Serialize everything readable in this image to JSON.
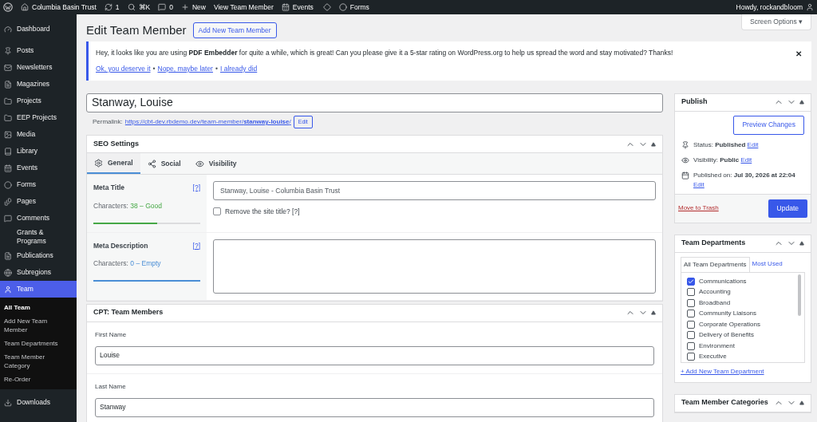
{
  "admin_bar": {
    "items": [
      "Columbia Basin Trust",
      "1",
      "⌘K",
      "0",
      "New",
      "View Team Member",
      "Events",
      "Forms"
    ],
    "account": "Howdy, rockandbloom"
  },
  "sidebar": {
    "items": [
      {
        "label": "Dashboard",
        "selected": false
      },
      {
        "label": "Posts",
        "selected": false
      },
      {
        "label": "Newsletters",
        "selected": false
      },
      {
        "label": "Magazines",
        "selected": false
      },
      {
        "label": "Projects",
        "selected": false
      },
      {
        "label": "EEP Projects",
        "selected": false
      },
      {
        "label": "Media",
        "selected": false
      },
      {
        "label": "Library",
        "selected": false
      },
      {
        "label": "Events",
        "selected": false
      },
      {
        "label": "Forms",
        "selected": false
      },
      {
        "label": "Pages",
        "selected": false
      },
      {
        "label": "Comments",
        "selected": false
      },
      {
        "label": "Grants & Programs",
        "selected": false
      },
      {
        "label": "Publications",
        "selected": false
      },
      {
        "label": "Subregions",
        "selected": false
      },
      {
        "label": "Team",
        "selected": true,
        "children": [
          {
            "label": "All Team",
            "selected": true
          },
          {
            "label": "Add New Team Member",
            "selected": false
          },
          {
            "label": "Team Departments",
            "selected": false
          },
          {
            "label": "Team Member Category",
            "selected": false
          },
          {
            "label": "Re-Order",
            "selected": false
          }
        ]
      },
      {
        "label": "Downloads",
        "selected": false
      }
    ]
  },
  "page": {
    "title": "Edit Team Member",
    "add_button": "Add New Team Member",
    "screen_options": "Screen Options ▾"
  },
  "notice": {
    "text": "Hey, it looks like you are using **PDF Embedder** for quite a while, which is great! Can you please give it a 5-star rating on WordPress.org to help us spread the word and stay motivated? Thanks!",
    "links": [
      "Ok, you deserve it",
      "Nope, maybe later",
      "I already did"
    ],
    "separator": "•",
    "dismiss": "✕"
  },
  "post_title": "Stanway, Louise",
  "permalink": {
    "label": "Permalink:",
    "url": "https://cbt-dev.rbdemo.dev/team-member/**stanway-louise**/",
    "edit": "Edit"
  },
  "seo": {
    "title": "SEO Settings",
    "tabs": [
      {
        "label": "General",
        "selected": true
      },
      {
        "label": "Social",
        "selected": false
      },
      {
        "label": "Visibility",
        "selected": false
      }
    ],
    "fields": [
      {
        "kind": "input",
        "label": "Meta Title",
        "help": "[?]",
        "counter": "Characters: ",
        "count": "38 – Good",
        "color": "#46a846",
        "level": 0.6,
        "value": "Stanway, Louise - Columbia Basin Trust",
        "checkbox": {
          "label": "Remove the site title? [?]",
          "checked": false
        }
      },
      {
        "kind": "textarea",
        "label": "Meta Description",
        "help": "[?]",
        "counter": "Characters: ",
        "count": "0 – Empty",
        "color": "#4a8ed6",
        "level": 1
      }
    ]
  },
  "cpt": {
    "title": "CPT: Team Members",
    "fields": [
      {
        "label": "First Name",
        "value": "Louise"
      },
      {
        "label": "Last Name",
        "value": "Stanway"
      }
    ]
  },
  "publish": {
    "title": "Publish",
    "preview": "Preview Changes",
    "rows": [
      {
        "text": "Status: **Published**",
        "edit": "Edit"
      },
      {
        "text": "Visibility: **Public**",
        "edit": "Edit"
      },
      {
        "text": "Published on: **Jul 30, 2026 at 22:04**",
        "edit": "Edit"
      }
    ],
    "trash": "Move to Trash",
    "update": "Update"
  },
  "departments": {
    "title": "Team Departments",
    "tabs": [
      {
        "label": "All Team Departments",
        "selected": true
      },
      {
        "label": "Most Used",
        "selected": false
      }
    ],
    "items": [
      {
        "label": "Communications",
        "checked": true
      },
      {
        "label": "Accounting",
        "checked": false
      },
      {
        "label": "Broadband",
        "checked": false
      },
      {
        "label": "Community Liaisons",
        "checked": false
      },
      {
        "label": "Corporate Operations",
        "checked": false
      },
      {
        "label": "Delivery of Benefits",
        "checked": false
      },
      {
        "label": "Environment",
        "checked": false
      },
      {
        "label": "Executive",
        "checked": false
      }
    ],
    "add_link": "+ Add New Team Department"
  },
  "categories": {
    "title": "Team Member Categories"
  }
}
